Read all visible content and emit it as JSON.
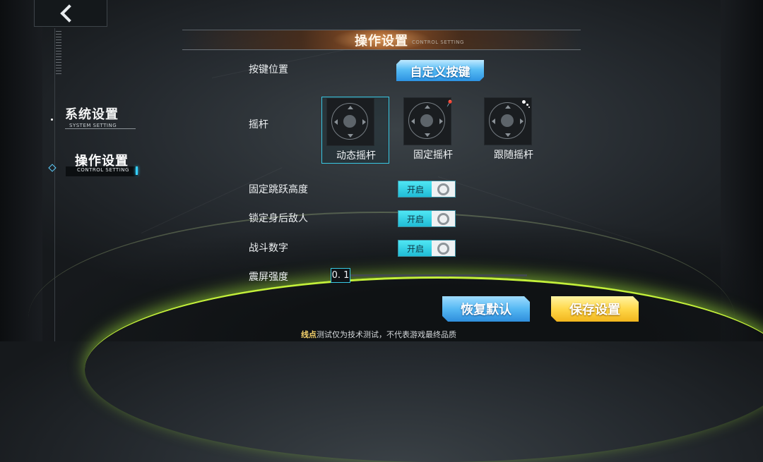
{
  "sidebar": {
    "items": [
      {
        "label": "系统设置",
        "sublabel": "SYSTEM SETTING"
      },
      {
        "label": "操作设置",
        "sublabel": "CONTROL SETTING"
      }
    ]
  },
  "header": {
    "title": "操作设置",
    "subtitle": "CONTROL SETTING"
  },
  "settings": {
    "key_position": {
      "label": "按键位置",
      "button": "自定义按键"
    },
    "joystick": {
      "label": "摇杆",
      "options": [
        {
          "label": "动态摇杆",
          "icon": "dynamic-joystick-icon"
        },
        {
          "label": "固定摇杆",
          "icon": "fixed-joystick-icon"
        },
        {
          "label": "跟随摇杆",
          "icon": "follow-joystick-icon"
        }
      ],
      "selected": "动态摇杆"
    },
    "fixed_jump_height": {
      "label": "固定跳跃高度",
      "toggle": "开启"
    },
    "lock_rear_enemy": {
      "label": "锁定身后敌人",
      "toggle": "开启"
    },
    "battle_numbers": {
      "label": "战斗数字",
      "toggle": "开启"
    },
    "screen_shake": {
      "label": "震屏强度",
      "value": "0. 1"
    }
  },
  "actions": {
    "restore": "恢复默认",
    "save": "保存设置"
  },
  "footer": {
    "brand": "线点",
    "text": "测试仅为技术测试，不代表游戏最终品质"
  },
  "colors": {
    "accent_cyan": "#38c8e3",
    "save_yellow": "#ffd84a",
    "restore_blue": "#55b8f3",
    "glow_green": "#c3f03a"
  }
}
